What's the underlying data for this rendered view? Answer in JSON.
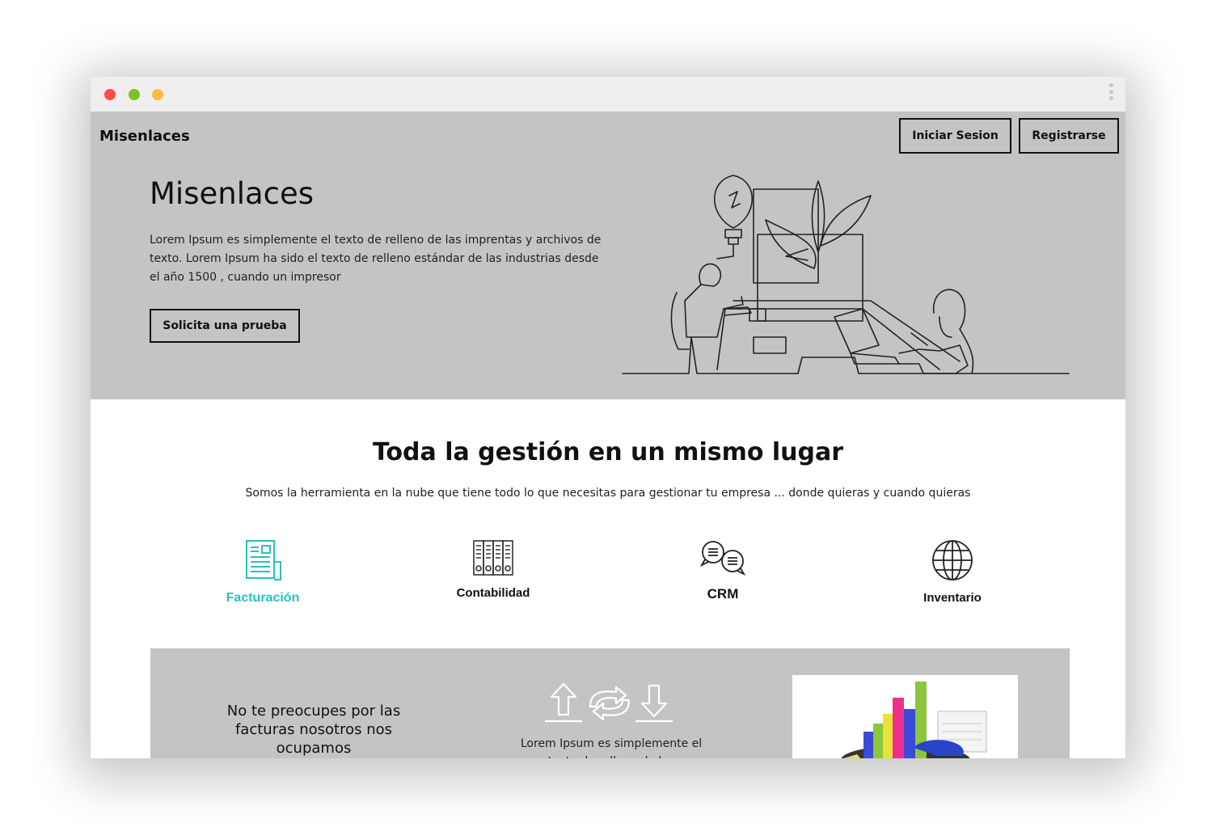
{
  "header": {
    "brand": "Misenlaces",
    "login_label": "Iniciar Sesion",
    "register_label": "Registrarse"
  },
  "hero": {
    "title": "Misenlaces",
    "description": "Lorem Ipsum es simplemente el texto de relleno de las imprentas y archivos de texto. Lorem Ipsum ha sido el texto de relleno estándar de las industrias desde el año 1500 , cuando un impresor",
    "cta_label": "Solicita una prueba"
  },
  "section": {
    "title": "Toda la gestión en un mismo lugar",
    "subtitle": "Somos la herramienta en la nube que tiene todo lo que necesitas para gestionar tu empresa ... donde quieras y cuando quieras"
  },
  "features": [
    {
      "label": "Facturación",
      "icon": "invoice-icon",
      "color": "#2bbfbf"
    },
    {
      "label": "Contabilidad",
      "icon": "binders-icon",
      "color": "#111111"
    },
    {
      "label": "CRM",
      "icon": "chat-bubbles-icon",
      "color": "#111111"
    },
    {
      "label": "Inventario",
      "icon": "globe-icon",
      "color": "#111111"
    }
  ],
  "promo": {
    "title": "No te preocupes por las facturas nosotros nos ocupamos",
    "text": "Lorem Ipsum es simplemente el texto de relleno de las"
  },
  "colors": {
    "hero_bg": "#c4c4c4",
    "accent": "#2bbfbf",
    "titlebar": "#efefef"
  }
}
